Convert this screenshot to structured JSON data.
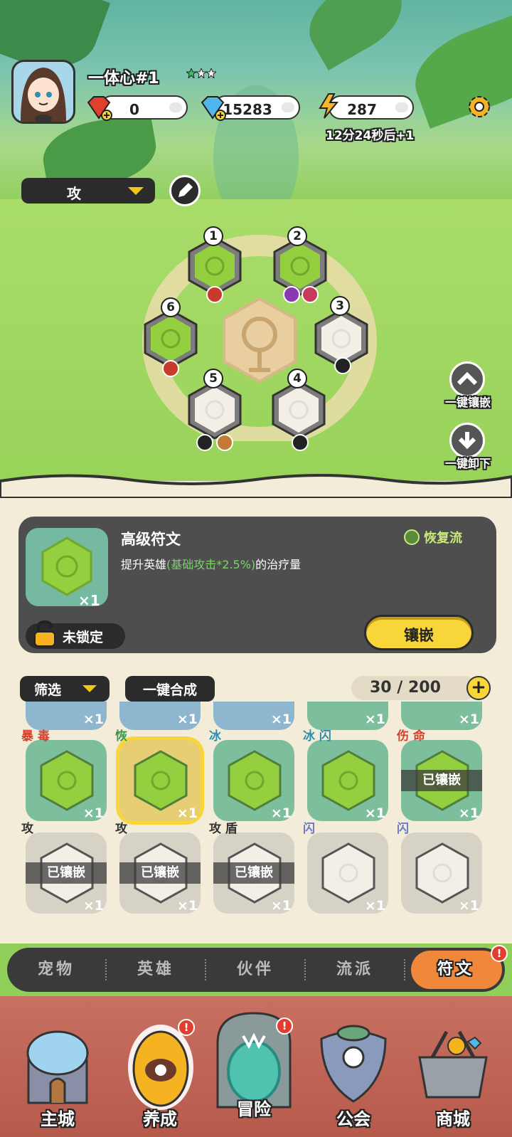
{
  "player": {
    "name": "一体心#1"
  },
  "resources": {
    "gems": "0",
    "diamonds": "15283",
    "energy": "287",
    "energy_timer": "12分24秒后+1"
  },
  "board": {
    "mode_label": "攻",
    "slots": [
      "1",
      "2",
      "3",
      "4",
      "5",
      "6"
    ]
  },
  "side_actions": {
    "equip_all": "一键镶嵌",
    "unequip_all": "一键卸下"
  },
  "detail": {
    "title": "高级符文",
    "desc_prefix": "提升英雄",
    "desc_highlight": "(基础攻击*2.5%)",
    "desc_suffix": "的治疗量",
    "school": "恢复流",
    "count": "×1",
    "lock_status": "未锁定",
    "embed_label": "镶嵌"
  },
  "inventory": {
    "filter_label": "筛选",
    "merge_label": "一键合成",
    "capacity": "30 / 200",
    "add_label": "+",
    "top_row_counts": [
      "×1",
      "×1",
      "×1",
      "×1",
      "×1"
    ],
    "row2": [
      {
        "tag": "暴 毒",
        "count": "×1"
      },
      {
        "tag": "恢",
        "count": "×1"
      },
      {
        "tag": "冰",
        "count": "×1"
      },
      {
        "tag": "冰 闪",
        "count": "×1"
      },
      {
        "tag": "伤 命",
        "count": "×1",
        "status": "已镶嵌"
      }
    ],
    "row3": [
      {
        "tag": "攻",
        "count": "×1",
        "status": "已镶嵌"
      },
      {
        "tag": "攻",
        "count": "×1",
        "status": "已镶嵌"
      },
      {
        "tag": "攻 盾",
        "count": "×1",
        "status": "已镶嵌"
      },
      {
        "tag": "闪",
        "count": "×1"
      },
      {
        "tag": "闪",
        "count": "×1"
      }
    ]
  },
  "tabs": [
    "宠物",
    "英雄",
    "伙伴",
    "流派",
    "符文"
  ],
  "nav": [
    "主城",
    "养成",
    "冒险",
    "公会",
    "商城"
  ],
  "badge": "!"
}
